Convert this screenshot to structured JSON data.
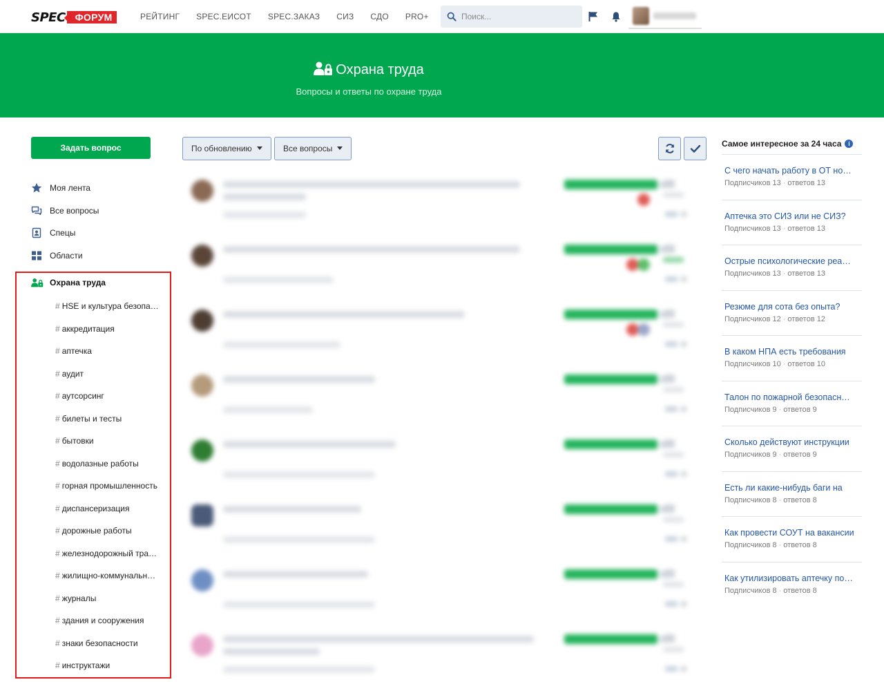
{
  "brand": {
    "part1": "SPEC",
    "part2": "ФОРУМ"
  },
  "nav": [
    "РЕЙТИНГ",
    "SPEC.ЕИСОТ",
    "SPEC.ЗАКАЗ",
    "СИЗ",
    "СДО",
    "PRO+"
  ],
  "search": {
    "placeholder": "Поиск..."
  },
  "hero": {
    "title": "Охрана труда",
    "subtitle": "Вопросы и ответы по охране труда"
  },
  "sidebar": {
    "ask_button": "Задать вопрос",
    "menu": [
      {
        "label": "Моя лента",
        "icon": "star-icon"
      },
      {
        "label": "Все вопросы",
        "icon": "chat-icon"
      },
      {
        "label": "Спецы",
        "icon": "id-card-icon"
      },
      {
        "label": "Области",
        "icon": "grid-icon"
      }
    ],
    "category": "Охрана труда",
    "tags": [
      "HSE и культура безопасности",
      "аккредитация",
      "аптечка",
      "аудит",
      "аутсорсинг",
      "билеты и тесты",
      "бытовки",
      "водолазные работы",
      "горная промышленность",
      "диспансеризация",
      "дорожные работы",
      "железнодорожный транспорт",
      "жилищно-коммунальное хозяйство",
      "журналы",
      "здания и сооружения",
      "знаки безопасности",
      "инструктажи"
    ]
  },
  "toolbar": {
    "sort_label": "По обновлению",
    "filter_label": "Все вопросы"
  },
  "right": {
    "title": "Самое интересное за 24 часа",
    "items": [
      {
        "q": "С чего начать работу в ОТ новичку?",
        "subs": "Подписчиков 13",
        "answers": "ответов 13"
      },
      {
        "q": "Аптечка это СИЗ или не СИЗ?",
        "subs": "Подписчиков 13",
        "answers": "ответов 13"
      },
      {
        "q": "Острые психологические реакции",
        "subs": "Подписчиков 13",
        "answers": "ответов 13"
      },
      {
        "q": "Резюме для сота без опыта?",
        "subs": "Подписчиков 12",
        "answers": "ответов 12"
      },
      {
        "q": "В каком НПА есть требования",
        "subs": "Подписчиков 10",
        "answers": "ответов 10"
      },
      {
        "q": "Талон по пожарной безопасности",
        "subs": "Подписчиков 9",
        "answers": "ответов 9"
      },
      {
        "q": "Сколько действуют инструкции",
        "subs": "Подписчиков 9",
        "answers": "ответов 9"
      },
      {
        "q": "Есть ли какие-нибудь баги на",
        "subs": "Подписчиков 8",
        "answers": "ответов 8"
      },
      {
        "q": "Как провести СОУТ на вакансии",
        "subs": "Подписчиков 8",
        "answers": "ответов 8"
      },
      {
        "q": "Как утилизировать аптечку после",
        "subs": "Подписчиков 8",
        "answers": "ответов 8"
      }
    ]
  },
  "colors": {
    "primary_green": "#00a74e",
    "link_blue": "#2456a6",
    "highlight_red": "#e11b1b",
    "brand_red": "#e0262a"
  }
}
